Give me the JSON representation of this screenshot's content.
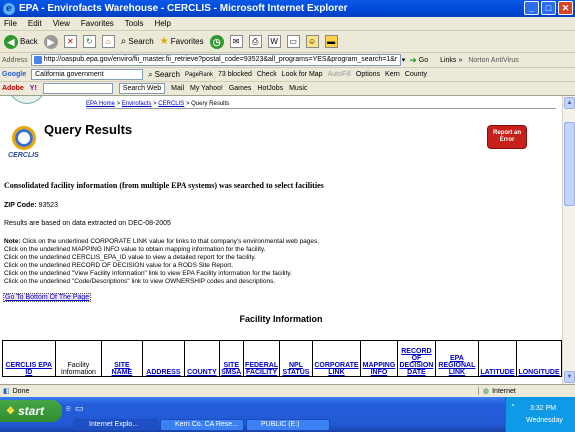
{
  "window": {
    "title": "EPA - Envirofacts Warehouse - CERCLIS - Microsoft Internet Explorer"
  },
  "menu": [
    "File",
    "Edit",
    "View",
    "Favorites",
    "Tools",
    "Help"
  ],
  "toolbar": {
    "back": "Back",
    "search": "Search",
    "favorites": "Favorites"
  },
  "address": {
    "label": "Address",
    "url": "http://oaspub.epa.gov/enviro/fii_master.fii_retrieve?postal_code=93523&all_programs=YES&program_search=1&r",
    "go": "Go",
    "links": "Links",
    "norton": "Norton AntiVirus"
  },
  "google_bar": {
    "label": "Google",
    "query": "California government",
    "search": "Search",
    "pagerank": "PageRank",
    "blocked": "73 blocked",
    "check": "Check",
    "lookup": "Look for Map",
    "autofill": "AutoFill",
    "options": "Options",
    "kern": "Kern",
    "county": "County"
  },
  "yahoo_bar": {
    "adobe": "Adobe",
    "search_web": "Search Web",
    "mail": "Mail",
    "my_yahoo": "My Yahoo!",
    "games": "Games",
    "hotjobs": "HotJobs",
    "music": "Music"
  },
  "page": {
    "breadcrumb": [
      "EPA Home",
      "Envirofacts",
      "CERCLIS",
      "Query Results"
    ],
    "title": "Query Results",
    "logo_label": "CERCLIS",
    "report_error": "Report an Error",
    "consolidated": "Consolidated facility information (from multiple EPA systems) was searched to select facilities",
    "zip_label": "ZIP Code:",
    "zip_value": "93523",
    "data_date": "Results are based on data extracted on DEC-08-2005",
    "note_label": "Note:",
    "notes": [
      " Click on the underlined CORPORATE LINK value for links to that company's environmental web pages.",
      "Click on the underlined MAPPING INFO value to obtain mapping information for the facility.",
      "Click on the underlined CERCLIS_EPA_ID value to view a detailed report for the facility.",
      "Click on the underlined RECORD OF DECISION value for a RODS Site Report.",
      "Click on the underlined \"View Facility Information\" link to view EPA Facility information for the facility.",
      "Click on the underlined \"Code/Descriptions\" link to view OWNERSHIP codes and descriptions."
    ],
    "bottom_link": "Go To Bottom Of The Page",
    "facility_heading": "Facility Information",
    "columns": [
      "CERCLIS EPA ID",
      "Facility Information",
      "SITE NAME",
      "ADDRESS",
      "COUNTY",
      "SITE SMSA",
      "FEDERAL FACILITY",
      "NPL STATUS",
      "CORPORATE LINK",
      "MAPPING INFO",
      "RECORD OF DECISION DATE",
      "EPA REGIONAL LINK",
      "LATITUDE",
      "LONGITUDE"
    ]
  },
  "status": {
    "left": "Done",
    "zone": "Internet"
  },
  "taskbar": {
    "start": "start",
    "tasks": [
      "Internet Explo...",
      "Kern Co. CA Rese...",
      "PUBLIC (E:)"
    ],
    "time": "3:32 PM",
    "day": "Wednesday"
  }
}
